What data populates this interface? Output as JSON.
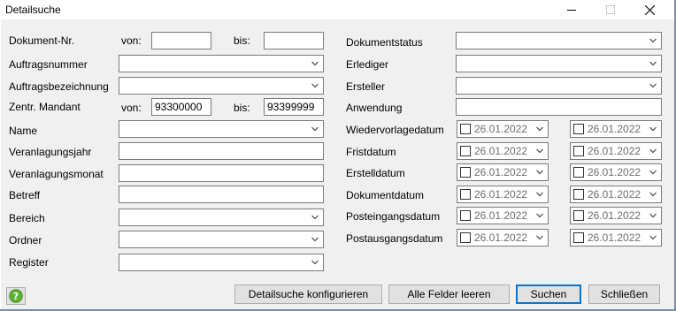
{
  "window": {
    "title": "Detailsuche"
  },
  "left": {
    "dokument_nr": {
      "label": "Dokument-Nr.",
      "von_label": "von:",
      "von_value": "",
      "bis_label": "bis:",
      "bis_value": ""
    },
    "auftragsnummer": {
      "label": "Auftragsnummer",
      "value": ""
    },
    "auftragsbezeichnung": {
      "label": "Auftragsbezeichnung",
      "value": ""
    },
    "zentr_mandant": {
      "label": "Zentr. Mandant",
      "von_label": "von:",
      "von_value": "93300000",
      "bis_label": "bis:",
      "bis_value": "93399999"
    },
    "name": {
      "label": "Name",
      "value": ""
    },
    "veranlagungsjahr": {
      "label": "Veranlagungsjahr",
      "value": ""
    },
    "veranlagungsmonat": {
      "label": "Veranlagungsmonat",
      "value": ""
    },
    "betreff": {
      "label": "Betreff",
      "value": ""
    },
    "bereich": {
      "label": "Bereich",
      "value": ""
    },
    "ordner": {
      "label": "Ordner",
      "value": ""
    },
    "register": {
      "label": "Register",
      "value": ""
    }
  },
  "right": {
    "dokumentstatus": {
      "label": "Dokumentstatus",
      "value": ""
    },
    "erlediger": {
      "label": "Erlediger",
      "value": ""
    },
    "ersteller": {
      "label": "Ersteller",
      "value": ""
    },
    "anwendung": {
      "label": "Anwendung",
      "value": ""
    },
    "date_rows": [
      {
        "label": "Wiedervorlagedatum",
        "from": "26.01.2022",
        "to": "26.01.2022"
      },
      {
        "label": "Fristdatum",
        "from": "26.01.2022",
        "to": "26.01.2022"
      },
      {
        "label": "Erstelldatum",
        "from": "26.01.2022",
        "to": "26.01.2022"
      },
      {
        "label": "Dokumentdatum",
        "from": "26.01.2022",
        "to": "26.01.2022"
      },
      {
        "label": "Posteingangsdatum",
        "from": "26.01.2022",
        "to": "26.01.2022"
      },
      {
        "label": "Postausgangsdatum",
        "from": "26.01.2022",
        "to": "26.01.2022"
      }
    ]
  },
  "buttons": {
    "configure": "Detailsuche konfigurieren",
    "clear": "Alle Felder leeren",
    "search": "Suchen",
    "close": "Schließen"
  },
  "icons": {
    "help": "help-icon",
    "minimize": "minimize-icon",
    "maximize": "maximize-icon",
    "close": "close-icon",
    "dropdown": "chevron-down-icon"
  },
  "colors": {
    "dialog_bg": "#f0f0f0",
    "default_button_border": "#0078d7",
    "help_icon": "#5cb130",
    "placeholder_text": "#6d6d6d"
  }
}
